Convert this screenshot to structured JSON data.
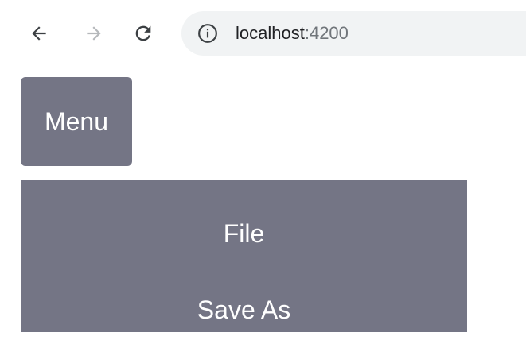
{
  "browser": {
    "url_host": "localhost",
    "url_port": ":4200",
    "icons": {
      "back": "arrow-left-icon",
      "forward": "arrow-right-icon",
      "reload": "reload-icon",
      "site_info": "info-icon"
    },
    "colors": {
      "toolbar_bg": "#ffffff",
      "omnibox_bg": "#f1f3f4",
      "icon_active": "#5f6368",
      "icon_disabled": "#c4c7c9"
    }
  },
  "page": {
    "menu_button_label": "Menu",
    "menu_items": [
      {
        "label": "File"
      },
      {
        "label": "Save As"
      }
    ],
    "colors": {
      "menu_bg": "#747585",
      "menu_text": "#ffffff"
    }
  }
}
